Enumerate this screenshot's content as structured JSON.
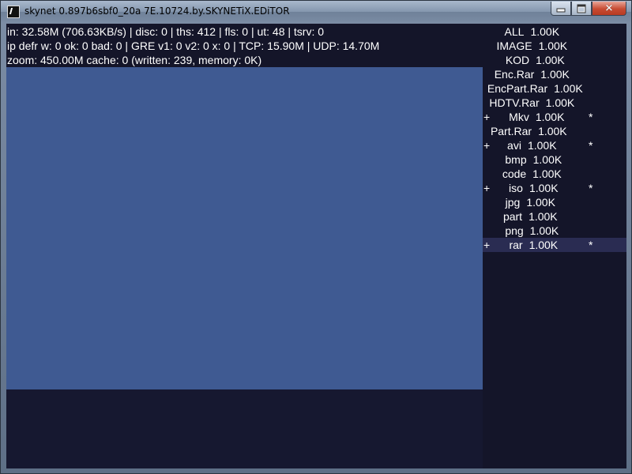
{
  "window": {
    "title": "skynet 0.897b6sbf0_20a 7E.10724.by.SKYNETiX.EDiTOR",
    "close_glyph": "✕"
  },
  "status": {
    "line1": "in: 32.58M (706.63KB/s) | disc: 0 | ths: 412 | fls: 0 | ut: 48 | tsrv: 0",
    "line2": "ip defr w: 0 ok: 0 bad: 0 | GRE v1: 0 v2: 0 x: 0 | TCP: 15.90M | UDP: 14.70M",
    "line3": "zoom: 450.00M cache: 0 (written: 239, memory: 0K)"
  },
  "categories": [
    {
      "label": "ALL",
      "size": "1.00K",
      "plus": "",
      "star": ""
    },
    {
      "label": "IMAGE",
      "size": "1.00K",
      "plus": "",
      "star": ""
    },
    {
      "label": "KOD",
      "size": "1.00K",
      "plus": "",
      "star": ""
    },
    {
      "label": "Enc.Rar",
      "size": "1.00K",
      "plus": "",
      "star": ""
    },
    {
      "label": "EncPart.Rar",
      "size": "1.00K",
      "plus": "",
      "star": ""
    },
    {
      "label": "HDTV.Rar",
      "size": "1.00K",
      "plus": "",
      "star": ""
    },
    {
      "label": "Mkv",
      "size": "1.00K",
      "plus": "+",
      "star": "*"
    },
    {
      "label": "Part.Rar",
      "size": "1.00K",
      "plus": "",
      "star": ""
    },
    {
      "label": "avi",
      "size": "1.00K",
      "plus": "+",
      "star": "*"
    },
    {
      "label": "bmp",
      "size": "1.00K",
      "plus": "",
      "star": ""
    },
    {
      "label": "code",
      "size": "1.00K",
      "plus": "",
      "star": ""
    },
    {
      "label": "iso",
      "size": "1.00K",
      "plus": "+",
      "star": "*"
    },
    {
      "label": "jpg",
      "size": "1.00K",
      "plus": "",
      "star": ""
    },
    {
      "label": "part",
      "size": "1.00K",
      "plus": "",
      "star": ""
    },
    {
      "label": "png",
      "size": "1.00K",
      "plus": "",
      "star": ""
    },
    {
      "label": "rar",
      "size": "1.00K",
      "plus": "+",
      "star": "*"
    }
  ],
  "selected_category": "rar",
  "colors": {
    "background": "#141529",
    "view_area": "#3f5a92",
    "selected_row": "#2a2c52",
    "text": "#ffffff"
  }
}
